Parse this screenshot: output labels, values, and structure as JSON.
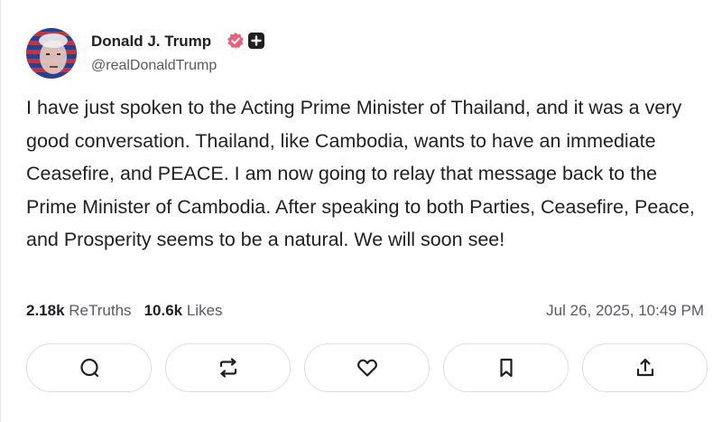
{
  "post": {
    "author_name": "Donald J. Trump",
    "handle": "@realDonaldTrump",
    "text": "I have just spoken to the Acting Prime Minister of Thailand, and it was a very good conversation. Thailand, like Cambodia, wants to have an immediate Ceasefire, and PEACE. I am now going to relay that message back to the Prime Minister of Cambodia. After speaking to both Parties, Ceasefire, Peace, and Prosperity seems to be a natural. We will soon see!",
    "retruths_count": "2.18k",
    "retruths_label": "ReTruths",
    "likes_count": "10.6k",
    "likes_label": "Likes",
    "timestamp": "Jul 26, 2025, 10:49 PM"
  },
  "icons": {
    "verified": "verified-badge-icon",
    "plus": "plus-badge-icon",
    "reply": "reply-icon",
    "retruth": "retruth-icon",
    "like": "heart-icon",
    "bookmark": "bookmark-icon",
    "share": "share-icon"
  },
  "colors": {
    "verified_badge": "#e5627e",
    "text_primary": "#1f1f24",
    "text_secondary": "#5a5a66",
    "button_border": "#dddde4"
  }
}
